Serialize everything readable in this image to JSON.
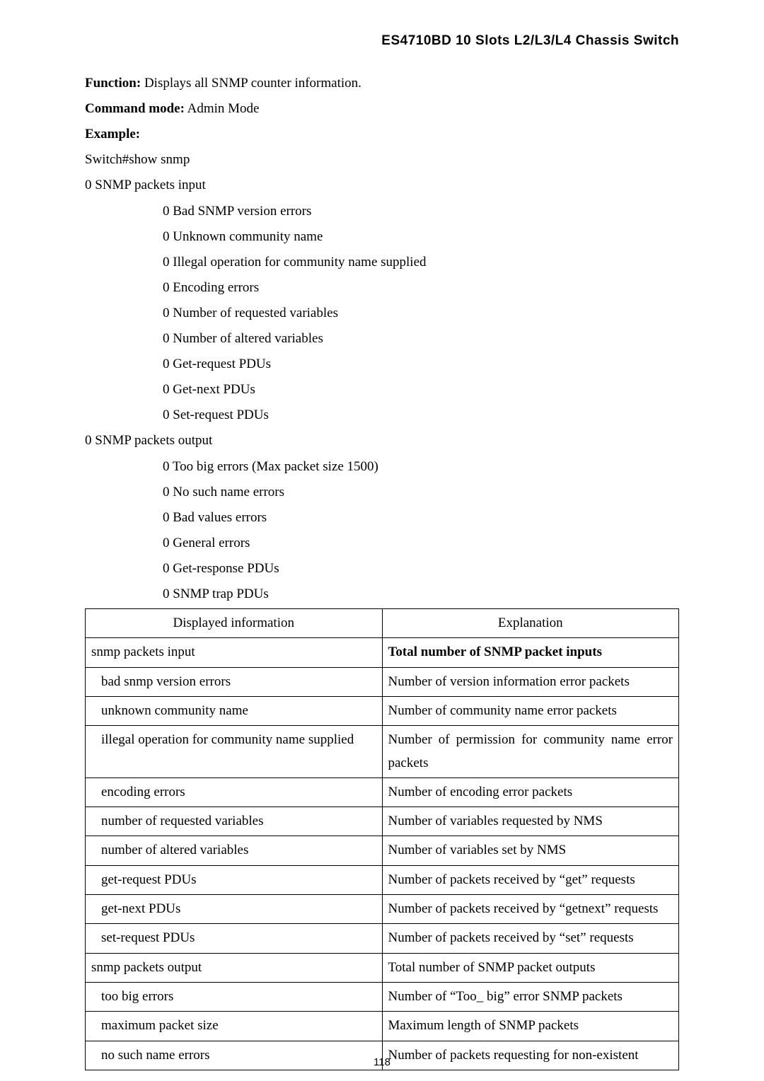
{
  "header": "ES4710BD 10 Slots L2/L3/L4 Chassis Switch",
  "lines": {
    "function_label": "Function:",
    "function_text": " Displays all SNMP counter information.",
    "command_label": "Command mode:",
    "command_text": " Admin Mode",
    "example_label": "Example:",
    "l1": "Switch#show snmp",
    "l2": "0 SNMP packets input",
    "i1": "0 Bad SNMP version errors",
    "i2": "0 Unknown community name",
    "i3": "0 Illegal operation for community name supplied",
    "i4": "0 Encoding errors",
    "i5": "0 Number of requested variables",
    "i6": "0 Number of altered variables",
    "i7": "0 Get-request PDUs",
    "i8": "0 Get-next PDUs",
    "i9": "0 Set-request PDUs",
    "l3": "0 SNMP packets output",
    "o1": "0 Too big errors (Max packet size 1500)",
    "o2": "0 No such name errors",
    "o3": "0 Bad values errors",
    "o4": "0 General errors",
    "o5": "0 Get-response PDUs",
    "o6": "0 SNMP trap PDUs"
  },
  "table": {
    "header_left": "Displayed information",
    "header_right": "Explanation",
    "rows": [
      {
        "left": "snmp packets input",
        "left_pad": false,
        "right": "Total number of SNMP packet inputs",
        "right_bold": true
      },
      {
        "left": "bad snmp version errors",
        "left_pad": true,
        "right": "Number of version information error packets"
      },
      {
        "left": "unknown community name",
        "left_pad": true,
        "right": "Number of community name error packets"
      },
      {
        "left": "illegal operation for community name supplied",
        "left_pad": true,
        "right": "Number of permission for community name error packets",
        "justify": true
      },
      {
        "left": "encoding errors",
        "left_pad": true,
        "right": "Number of encoding error packets"
      },
      {
        "left": "number of requested variables",
        "left_pad": true,
        "right": "Number of variables requested by NMS"
      },
      {
        "left": "number of altered variables",
        "left_pad": true,
        "right": "Number of variables set by NMS"
      },
      {
        "left": "get-request PDUs",
        "left_pad": true,
        "right": "Number of packets received by “get” requests"
      },
      {
        "left": "get-next PDUs",
        "left_pad": true,
        "right": "Number of packets received by “getnext” requests",
        "justify": true
      },
      {
        "left": "set-request PDUs",
        "left_pad": true,
        "right": "Number of packets received by “set” requests"
      },
      {
        "left": "snmp packets output",
        "left_pad": false,
        "right": "Total number of SNMP packet outputs"
      },
      {
        "left": "too big errors",
        "left_pad": true,
        "right": "Number of “Too_ big” error SNMP packets"
      },
      {
        "left": "maximum packet size",
        "left_pad": true,
        "right": "Maximum length of SNMP packets"
      },
      {
        "left": "no such name errors",
        "left_pad": true,
        "right": "Number of packets requesting for non-existent"
      }
    ]
  },
  "page_number": "118"
}
